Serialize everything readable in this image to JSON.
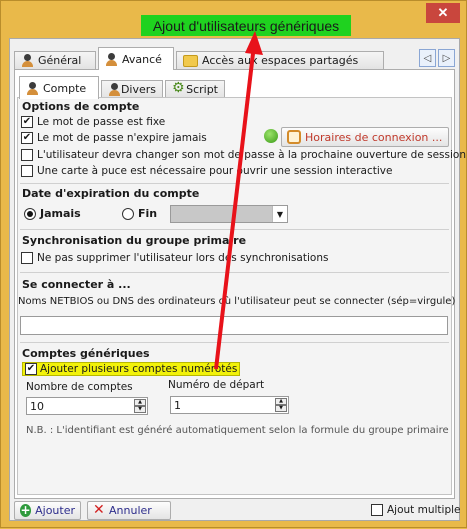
{
  "window": {
    "title": "Ajout d'utilisateurs génériques",
    "close_glyph": "✕"
  },
  "tabs": [
    {
      "label": "Général",
      "icon": "user-icon",
      "active": false
    },
    {
      "label": "Avancé",
      "icon": "user-icon",
      "active": true
    },
    {
      "label": "Accès aux espaces partagés",
      "icon": "folder-icon",
      "active": false
    }
  ],
  "tab_scroll": {
    "prev": "◁",
    "next": "▷"
  },
  "subtabs": [
    {
      "label": "Compte",
      "icon": "user-icon",
      "active": true
    },
    {
      "label": "Divers",
      "icon": "user-icon",
      "active": false
    },
    {
      "label": "Script",
      "icon": "script-icon",
      "active": false
    }
  ],
  "account_options": {
    "title": "Options de compte",
    "items": [
      {
        "label": "Le mot de passe est fixe",
        "checked": true
      },
      {
        "label": "Le mot de passe n'expire jamais",
        "checked": true
      },
      {
        "label": "L'utilisateur devra changer son mot de passe à la prochaine ouverture de session",
        "checked": false
      },
      {
        "label": "Une carte à puce est nécessaire pour ouvrir une session interactive",
        "checked": false
      }
    ],
    "hours_button": "Horaires de connexion ...",
    "status_color": "#3a9a17"
  },
  "expiration": {
    "title": "Date d'expiration du compte",
    "never_label": "Jamais",
    "end_label": "Fin",
    "selected": "Jamais",
    "combo_arrow": "▼"
  },
  "sync": {
    "title": "Synchronisation du groupe primaire",
    "checkbox_label": "Ne pas supprimer l'utilisateur lors des synchronisations",
    "checked": false
  },
  "connect": {
    "title": "Se connecter à ...",
    "field_label": "Noms NETBIOS ou DNS des ordinateurs où l'utilisateur peut se connecter (sép=virgule)",
    "value": ""
  },
  "generic": {
    "title": "Comptes génériques",
    "multi_label": "Ajouter plusieurs comptes numérotés",
    "multi_checked": true,
    "count_label": "Nombre de comptes",
    "count_value": "10",
    "start_label": "Numéro de départ",
    "start_value": "1",
    "note": "N.B. : L'identifiant est généré automatiquement selon la formule du groupe  primaire",
    "spin_up": "▲",
    "spin_down": "▼"
  },
  "footer": {
    "add_label": "Ajouter",
    "cancel_label": "Annuler",
    "multi_label": "Ajout multiple",
    "multi_checked": false
  },
  "colors": {
    "title_highlight": "#1fd21f",
    "checkbox_highlight": "#f2f20a",
    "annotation_arrow": "#e8121a",
    "window_frame": "#e9b94a"
  }
}
